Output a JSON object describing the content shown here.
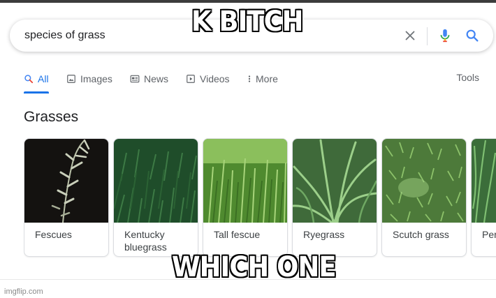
{
  "search": {
    "query": "species of grass"
  },
  "tabs": [
    {
      "label": "All",
      "icon": "search-icon",
      "active": true
    },
    {
      "label": "Images",
      "icon": "image-icon"
    },
    {
      "label": "News",
      "icon": "news-icon"
    },
    {
      "label": "Videos",
      "icon": "play-icon"
    },
    {
      "label": "More",
      "icon": "more-vert-icon"
    }
  ],
  "tools_label": "Tools",
  "section_title": "Grasses",
  "cards": [
    {
      "label": "Fescues"
    },
    {
      "label": "Kentucky bluegrass"
    },
    {
      "label": "Tall fescue"
    },
    {
      "label": "Ryegrass"
    },
    {
      "label": "Scutch grass"
    },
    {
      "label": "Perennial ryegrass",
      "visible_label": "Per rye"
    }
  ],
  "meme": {
    "top_text": "K BITCH",
    "bottom_text": "WHICH ONE"
  },
  "watermark": "imgflip.com",
  "colors": {
    "accent": "#1a73e8",
    "tab_text": "#5f6368",
    "mic_blue": "#4285f4",
    "mic_red": "#ea4335"
  }
}
